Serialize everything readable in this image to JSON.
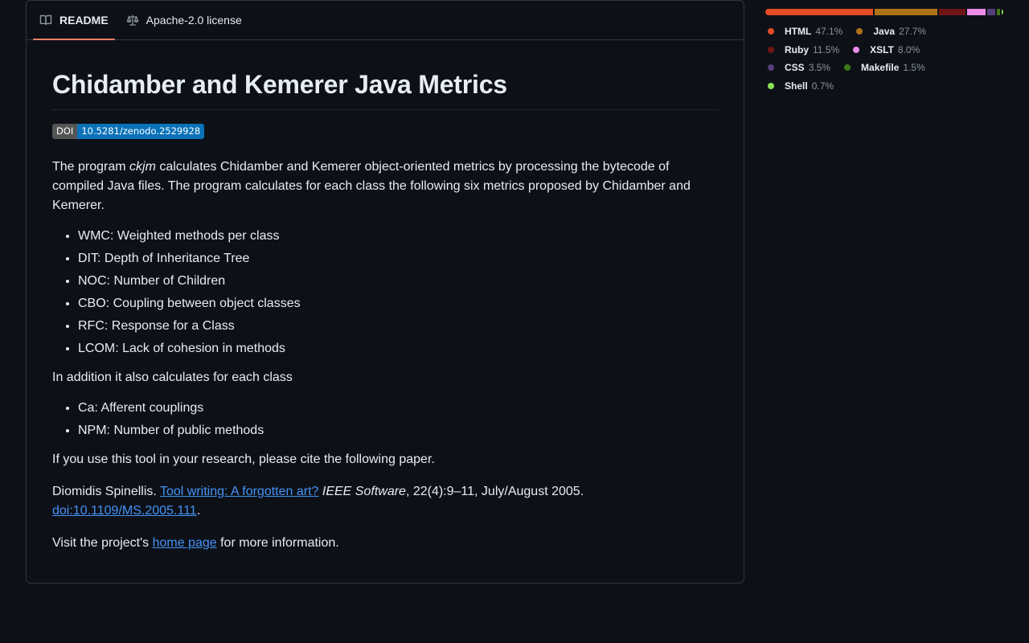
{
  "tabs": {
    "readme_label": "README",
    "license_label": "Apache-2.0 license"
  },
  "readme": {
    "title": "Chidamber and Kemerer Java Metrics",
    "doi_badge": {
      "label": "DOI",
      "value": "10.5281/zenodo.2529928"
    },
    "intro": {
      "prefix": "The program ",
      "program_name": "ckjm",
      "suffix": " calculates Chidamber and Kemerer object-oriented metrics by processing the bytecode of compiled Java files. The program calculates for each class the following six metrics proposed by Chidamber and Kemerer."
    },
    "metrics": [
      "WMC: Weighted methods per class",
      "DIT: Depth of Inheritance Tree",
      "NOC: Number of Children",
      "CBO: Coupling between object classes",
      "RFC: Response for a Class",
      "LCOM: Lack of cohesion in methods"
    ],
    "additional_intro": "In addition it also calculates for each class",
    "additional_metrics": [
      "Ca: Afferent couplings",
      "NPM: Number of public methods"
    ],
    "cite_text": "If you use this tool in your research, please cite the following paper.",
    "reference": {
      "author": "Diomidis Spinellis. ",
      "title_link": "Tool writing: A forgotten art?",
      "journal": "IEEE Software",
      "details": ", 22(4):9–11, July/August 2005.",
      "doi_link": "doi:10.1109/MS.2005.111",
      "end": "."
    },
    "visit": {
      "prefix": "Visit the project's ",
      "link": "home page",
      "suffix": " for more information."
    }
  },
  "languages": [
    {
      "name": "HTML",
      "percent": "47.1%",
      "value": 47.1,
      "color": "#e34c26"
    },
    {
      "name": "Java",
      "percent": "27.7%",
      "value": 27.7,
      "color": "#b07219"
    },
    {
      "name": "Ruby",
      "percent": "11.5%",
      "value": 11.5,
      "color": "#701516"
    },
    {
      "name": "XSLT",
      "percent": "8.0%",
      "value": 8.0,
      "color": "#eb8ceb"
    },
    {
      "name": "CSS",
      "percent": "3.5%",
      "value": 3.5,
      "color": "#563d7c"
    },
    {
      "name": "Makefile",
      "percent": "1.5%",
      "value": 1.5,
      "color": "#427819"
    },
    {
      "name": "Shell",
      "percent": "0.7%",
      "value": 0.7,
      "color": "#89e051"
    }
  ]
}
